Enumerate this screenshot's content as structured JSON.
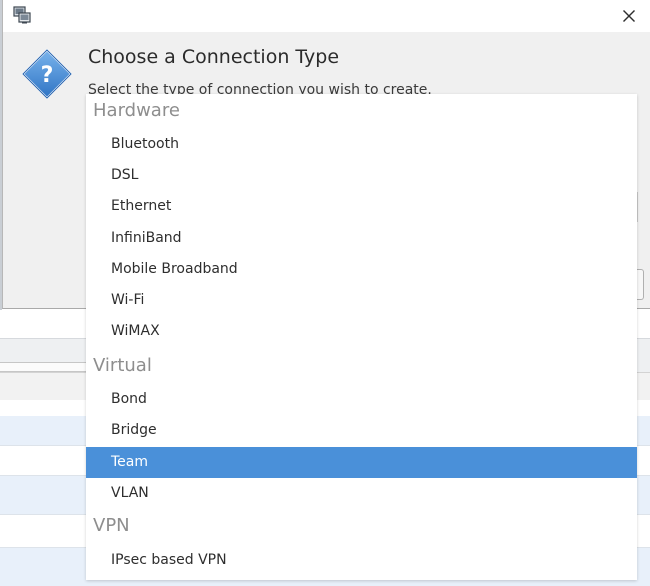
{
  "dialog": {
    "title": "Choose a Connection Type",
    "subtitle": "Select the type of connection you wish to create."
  },
  "icons": {
    "app": "network-connections-icon",
    "close": "close-icon",
    "question": "question-icon"
  },
  "menu": {
    "sections": [
      {
        "header": "Hardware",
        "items": [
          "Bluetooth",
          "DSL",
          "Ethernet",
          "InfiniBand",
          "Mobile Broadband",
          "Wi-Fi",
          "WiMAX"
        ]
      },
      {
        "header": "Virtual",
        "items": [
          "Bond",
          "Bridge",
          "Team",
          "VLAN"
        ]
      },
      {
        "header": "VPN",
        "items": [
          "IPsec based VPN"
        ]
      }
    ],
    "selected": "Team"
  },
  "colors": {
    "selection": "#4a90d9",
    "header_text": "#8e8e8e",
    "dialog_bg": "#f0f0f0",
    "question_icon": "#4a8fd6",
    "row_alt": "#e8f0fa"
  }
}
